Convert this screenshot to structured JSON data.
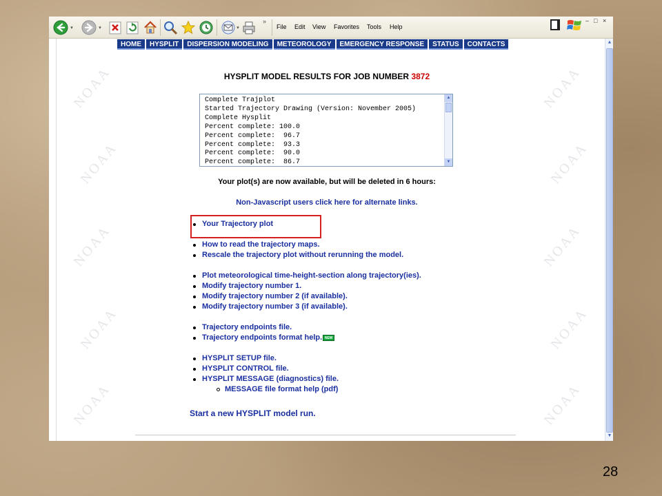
{
  "toolbar": {
    "buttons": [
      {
        "icon": "back-arrow-icon"
      },
      {
        "icon": "forward-arrow-icon"
      },
      {
        "icon": "stop-icon"
      },
      {
        "icon": "refresh-icon"
      },
      {
        "icon": "home-icon"
      },
      {
        "icon": "search-icon"
      },
      {
        "icon": "favorites-star-icon"
      },
      {
        "icon": "history-icon"
      },
      {
        "icon": "mail-icon"
      },
      {
        "icon": "print-icon"
      }
    ],
    "overflow": "»",
    "menu": [
      "File",
      "Edit",
      "View",
      "Favorites",
      "Tools",
      "Help"
    ],
    "window_controls": {
      "minimize": "–",
      "maximize": "□",
      "close": "×"
    }
  },
  "nav": {
    "items": [
      "HOME",
      "HYSPLIT",
      "DISPERSION MODELING",
      "METEOROLOGY",
      "EMERGENCY RESPONSE",
      "STATUS",
      "CONTACTS"
    ],
    "color": "#1a3a8a"
  },
  "results": {
    "title_prefix": "HYSPLIT MODEL RESULTS FOR JOB NUMBER ",
    "job_number": "3872",
    "log_lines": [
      "Complete Trajplot",
      "Started Trajectory Drawing (Version: November 2005)",
      "Complete Hysplit",
      "Percent complete: 100.0",
      "Percent complete:  96.7",
      "Percent complete:  93.3",
      "Percent complete:  90.0",
      "Percent complete:  86.7"
    ],
    "availability_message": "Your plot(s) are now available, but will be deleted in 6 hours:",
    "alternate_links": "Non-Javascript users click here for alternate links."
  },
  "links": {
    "trajectory_plot": "Your Trajectory plot",
    "read_maps": "How to read the trajectory maps.",
    "rescale": "Rescale the trajectory plot without rerunning the model.",
    "plot_met": "Plot meteorological time-height-section along trajectory(ies).",
    "modify_1": "Modify trajectory number 1.",
    "modify_2": "Modify trajectory number 2 (if available).",
    "modify_3": "Modify trajectory number 3 (if available).",
    "endpoints": "Trajectory endpoints file.",
    "endpoints_format": "Trajectory endpoints format help.",
    "new_badge": "NEW",
    "setup": "HYSPLIT SETUP file.",
    "control": "HYSPLIT CONTROL file.",
    "message": "HYSPLIT MESSAGE (diagnostics) file.",
    "message_help": "MESSAGE file format help (pdf)"
  },
  "start_run": {
    "prefix": "Start a new ",
    "product": "HYSPLIT",
    "suffix": " model run."
  },
  "watermark": "NOAA",
  "slide_number": "28",
  "colors": {
    "link": "#1a2fa0",
    "job_number": "#cc0000",
    "highlight": "#d42020"
  }
}
